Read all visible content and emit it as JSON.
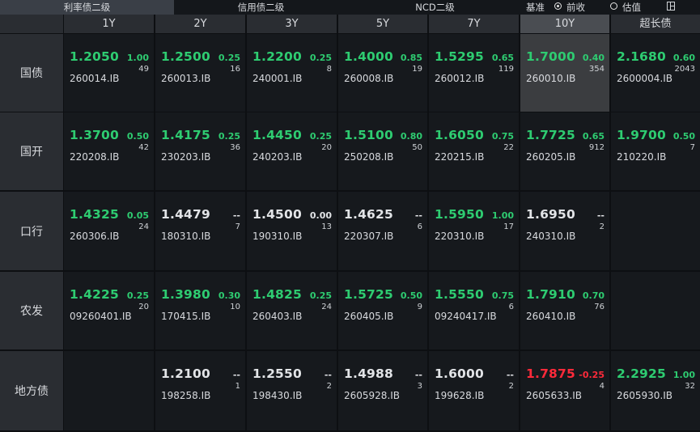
{
  "tabs": [
    {
      "label": "利率债二级",
      "active": true
    },
    {
      "label": "信用债二级",
      "active": false
    },
    {
      "label": "NCD二级",
      "active": false
    }
  ],
  "options": {
    "basis_label": "基准",
    "prev_close_label": "前收",
    "valuation_label": "估值",
    "selected": "前收"
  },
  "columns": [
    "1Y",
    "2Y",
    "3Y",
    "5Y",
    "7Y",
    "10Y",
    "超长债"
  ],
  "selected_column": "10Y",
  "colors": {
    "up": "#2ecc71",
    "down": "#ff2a3a",
    "flat": "#e2e4e7",
    "selected_bg": "#3b3d40"
  },
  "rows": [
    {
      "label": "国债",
      "cells": [
        {
          "rate": "1.2050",
          "change": "1.00",
          "volume": "49",
          "code": "260014.IB",
          "dir": "up"
        },
        {
          "rate": "1.2500",
          "change": "0.25",
          "volume": "16",
          "code": "260013.IB",
          "dir": "up"
        },
        {
          "rate": "1.2200",
          "change": "0.25",
          "volume": "8",
          "code": "240001.IB",
          "dir": "up"
        },
        {
          "rate": "1.4000",
          "change": "0.85",
          "volume": "19",
          "code": "260008.IB",
          "dir": "up"
        },
        {
          "rate": "1.5295",
          "change": "0.65",
          "volume": "119",
          "code": "260012.IB",
          "dir": "up"
        },
        {
          "rate": "1.7000",
          "change": "0.40",
          "volume": "354",
          "code": "260010.IB",
          "dir": "up",
          "selected": true
        },
        {
          "rate": "2.1680",
          "change": "0.60",
          "volume": "2043",
          "code": "2600004.IB",
          "dir": "up"
        }
      ]
    },
    {
      "label": "国开",
      "cells": [
        {
          "rate": "1.3700",
          "change": "0.50",
          "volume": "42",
          "code": "220208.IB",
          "dir": "up"
        },
        {
          "rate": "1.4175",
          "change": "0.25",
          "volume": "36",
          "code": "230203.IB",
          "dir": "up"
        },
        {
          "rate": "1.4450",
          "change": "0.25",
          "volume": "20",
          "code": "240203.IB",
          "dir": "up"
        },
        {
          "rate": "1.5100",
          "change": "0.80",
          "volume": "50",
          "code": "250208.IB",
          "dir": "up"
        },
        {
          "rate": "1.6050",
          "change": "0.75",
          "volume": "22",
          "code": "220215.IB",
          "dir": "up"
        },
        {
          "rate": "1.7725",
          "change": "0.65",
          "volume": "912",
          "code": "260205.IB",
          "dir": "up"
        },
        {
          "rate": "1.9700",
          "change": "0.50",
          "volume": "7",
          "code": "210220.IB",
          "dir": "up"
        }
      ]
    },
    {
      "label": "口行",
      "cells": [
        {
          "rate": "1.4325",
          "change": "0.05",
          "volume": "24",
          "code": "260306.IB",
          "dir": "up"
        },
        {
          "rate": "1.4479",
          "change": "--",
          "volume": "7",
          "code": "180310.IB",
          "dir": "flat"
        },
        {
          "rate": "1.4500",
          "change": "0.00",
          "volume": "13",
          "code": "190310.IB",
          "dir": "flat"
        },
        {
          "rate": "1.4625",
          "change": "--",
          "volume": "6",
          "code": "220307.IB",
          "dir": "flat"
        },
        {
          "rate": "1.5950",
          "change": "1.00",
          "volume": "17",
          "code": "220310.IB",
          "dir": "up"
        },
        {
          "rate": "1.6950",
          "change": "--",
          "volume": "2",
          "code": "240310.IB",
          "dir": "flat"
        },
        null
      ]
    },
    {
      "label": "农发",
      "cells": [
        {
          "rate": "1.4225",
          "change": "0.25",
          "volume": "20",
          "code": "09260401.IB",
          "dir": "up"
        },
        {
          "rate": "1.3980",
          "change": "0.30",
          "volume": "10",
          "code": "170415.IB",
          "dir": "up"
        },
        {
          "rate": "1.4825",
          "change": "0.25",
          "volume": "24",
          "code": "260403.IB",
          "dir": "up"
        },
        {
          "rate": "1.5725",
          "change": "0.50",
          "volume": "9",
          "code": "260405.IB",
          "dir": "up"
        },
        {
          "rate": "1.5550",
          "change": "0.75",
          "volume": "6",
          "code": "09240417.IB",
          "dir": "up"
        },
        {
          "rate": "1.7910",
          "change": "0.70",
          "volume": "76",
          "code": "260410.IB",
          "dir": "up"
        },
        null
      ]
    },
    {
      "label": "地方债",
      "cells": [
        null,
        {
          "rate": "1.2100",
          "change": "--",
          "volume": "1",
          "code": "198258.IB",
          "dir": "flat"
        },
        {
          "rate": "1.2550",
          "change": "--",
          "volume": "2",
          "code": "198430.IB",
          "dir": "flat"
        },
        {
          "rate": "1.4988",
          "change": "--",
          "volume": "3",
          "code": "2605928.IB",
          "dir": "flat"
        },
        {
          "rate": "1.6000",
          "change": "--",
          "volume": "2",
          "code": "199628.IB",
          "dir": "flat"
        },
        {
          "rate": "1.7875",
          "change": "-0.25",
          "volume": "4",
          "code": "2605633.IB",
          "dir": "down"
        },
        {
          "rate": "2.2925",
          "change": "1.00",
          "volume": "32",
          "code": "2605930.IB",
          "dir": "up"
        }
      ]
    }
  ]
}
